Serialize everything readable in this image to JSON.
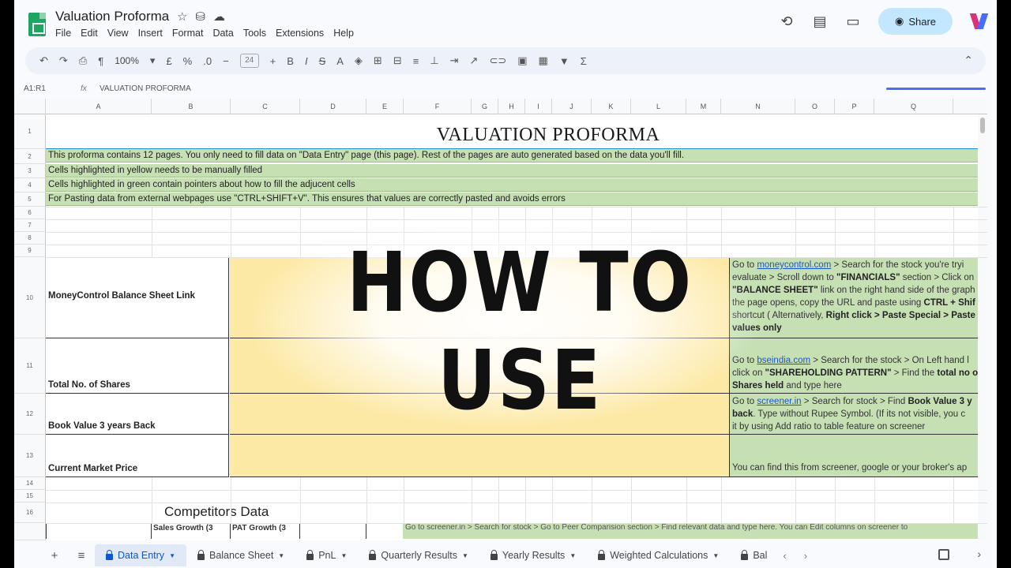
{
  "app": {
    "doc_title": "Valuation Proforma",
    "menu": [
      "File",
      "Edit",
      "View",
      "Insert",
      "Format",
      "Data",
      "Tools",
      "Extensions",
      "Help"
    ],
    "share_label": "Share"
  },
  "toolbar": {
    "zoom": "100%",
    "font_size": "24"
  },
  "formula_bar": {
    "cell_ref": "A1:R1",
    "fx": "fx",
    "content": "VALUATION PROFORMA"
  },
  "columns": [
    "A",
    "B",
    "C",
    "D",
    "E",
    "F",
    "G",
    "H",
    "I",
    "J",
    "K",
    "L",
    "M",
    "N",
    "O",
    "P",
    "Q"
  ],
  "rows": [
    "1",
    "2",
    "3",
    "4",
    "5",
    "6",
    "7",
    "8",
    "9",
    "10",
    "11",
    "12",
    "13",
    "14",
    "15",
    "16"
  ],
  "sheet": {
    "title": "VALUATION PROFORMA",
    "notes": [
      "This proforma contains 12 pages. You only need to fill data on \"Data Entry\" page (this page). Rest of the pages are auto generated based on the data you'll fill.",
      "Cells highlighted in yellow needs to be manually filled",
      "Cells highlighted in green contain pointers about how to fill the adjucent cells",
      "For Pasting data from external webpages use \"CTRL+SHIFT+V\". This ensures that values are correctly pasted and avoids errors"
    ],
    "fields": [
      {
        "label": "MoneyControl Balance Sheet Link",
        "help": [
          "Go to moneycontrol.com > Search for the stock you're tryi",
          "evaluate > Scroll down to \"FINANCIALS\" section > Click on",
          "\"BALANCE SHEET\" link on the right hand side of the graph",
          "the page opens, copy the URL and paste using CTRL + Shif",
          "shortcut ( Alternatively, Right click > Paste Special > Paste",
          "values only"
        ]
      },
      {
        "label": "Total No. of Shares",
        "help": [
          "Go to bseindia.com > Search for the stock > On Left hand l",
          "click on \"SHAREHOLDING PATTERN\" > Find the total no of",
          "Shares held and type here"
        ]
      },
      {
        "label": "Book Value 3 years Back",
        "help": [
          "Go to screener.in > Search for stock > Find Book Value 3 y",
          "back. Type without Rupee Symbol. (If its not visible, you c",
          "it by using Add ratio to table feature on screener"
        ]
      },
      {
        "label": "Current Market Price",
        "help": [
          "You can find this from screener, google or your broker's ap"
        ]
      }
    ],
    "competitors_title": "Competitors Data",
    "competitor_headers": [
      "",
      "Sales Growth (3",
      "PAT Growth (3",
      "",
      ""
    ],
    "competitor_help": "Go to screener.in > Search for stock > Go to Peer Comparision section > Find relevant data and type here. You can Edit columns on screener to"
  },
  "overlay": {
    "text": "HOW TO USE"
  },
  "tabs": [
    {
      "label": "Data Entry",
      "active": true
    },
    {
      "label": "Balance Sheet",
      "active": false
    },
    {
      "label": "PnL",
      "active": false
    },
    {
      "label": "Quarterly Results",
      "active": false
    },
    {
      "label": "Yearly Results",
      "active": false
    },
    {
      "label": "Weighted Calculations",
      "active": false
    },
    {
      "label": "Bal",
      "active": false
    }
  ],
  "colors": {
    "input_yellow": "#fde9a6",
    "help_green": "#c6e0b4",
    "accent_blue": "#0b57d0",
    "share_bg": "#c2e7ff"
  }
}
